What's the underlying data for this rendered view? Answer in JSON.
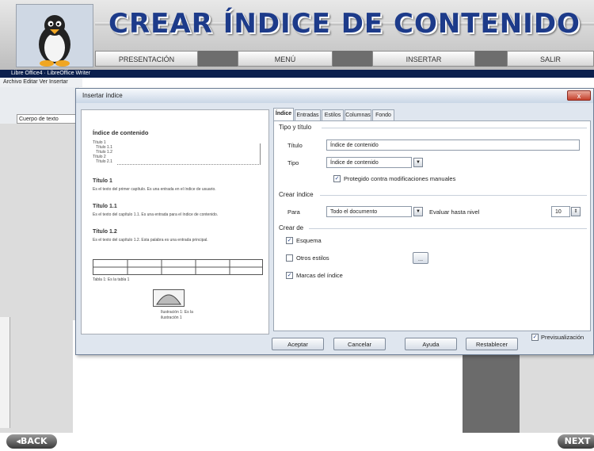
{
  "banner": {
    "title": "CREAR ÍNDICE DE CONTENIDO",
    "nav": [
      "PRESENTACIÓN",
      "MENÚ",
      "INSERTAR",
      "SALIR"
    ]
  },
  "writer": {
    "app_title": "Libre Office4 · LibreOffice Writer",
    "menu": "Archivo  Editar  Ver  Insertar  Formato  Tabla",
    "style_box": "Cuerpo de texto"
  },
  "dialog": {
    "title": "Insertar índice",
    "close": "x",
    "tabs": [
      "Índice",
      "Entradas",
      "Estilos",
      "Columnas",
      "Fondo"
    ],
    "active_tab": "Índice",
    "preview": {
      "heading": "Índice de contenido",
      "toc_lines": [
        "Título 1",
        "Título 1.1",
        "Título 1.2",
        "Título 2",
        "Título 2.1"
      ],
      "sections": [
        {
          "title": "Título 1",
          "text": "Es el texto del primer capítulo. Es una entrada en el índice de usuario."
        },
        {
          "title": "Título 1.1",
          "text": "Es el texto del capítulo 1.1. Es una entrada para el índice de contenido."
        },
        {
          "title": "Título 1.2",
          "text": "Es el texto del capítulo 1.2. Esta palabra es una entrada principal."
        }
      ],
      "table_caption": "Tabla 1: Es la tabla 1",
      "image_caption": "Ilustración 1: Es la ilustración 1"
    },
    "type_title": {
      "group": "Tipo y título",
      "title_label": "Título",
      "title_value": "Índice de contenido",
      "type_label": "Tipo",
      "type_value": "Índice de contenido",
      "protect_label": "Protegido contra modificaciones manuales",
      "protect_checked": true
    },
    "create_index": {
      "group": "Crear índice",
      "for_label": "Para",
      "for_value": "Todo el documento",
      "level_label": "Evaluar hasta nivel",
      "level_value": "10"
    },
    "create_from": {
      "group": "Crear de",
      "outline_label": "Esquema",
      "outline_checked": true,
      "other_label": "Otros estilos",
      "other_checked": false,
      "marks_label": "Marcas del índice",
      "marks_checked": true,
      "browse_label": "..."
    },
    "buttons": {
      "accept": "Aceptar",
      "cancel": "Cancelar",
      "help": "Ayuda",
      "reset": "Restablecer"
    },
    "preview_toggle": {
      "label": "Previsualización",
      "checked": true
    }
  },
  "nav_buttons": {
    "back": "◂BACK",
    "next": "NEXT"
  },
  "colors": {
    "title_blue": "#1d3b8a",
    "writer_bar": "#0b1f4d",
    "dialog_bg": "#dfe6ef"
  }
}
